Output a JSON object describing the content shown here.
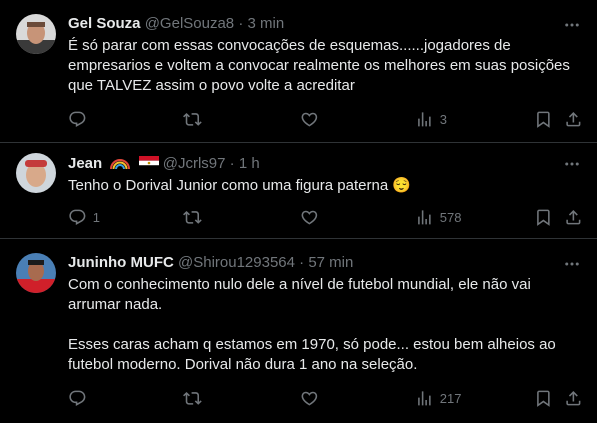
{
  "tweets": [
    {
      "name": "Gel Souza",
      "handle": "@GelSouza8",
      "time": "3 min",
      "text": [
        "É só parar com essas convocações de esquemas......jogadores de empresarios e voltem a convocar realmente os melhores em suas posições que TALVEZ assim o povo volte a acreditar"
      ],
      "replies": "",
      "reposts": "",
      "likes": "",
      "views": "3"
    },
    {
      "name": "Jean",
      "handle": "@Jcrls97",
      "time": "1 h",
      "text": [
        "Tenho o Dorival Junior como uma figura paterna 😌"
      ],
      "replies": "1",
      "reposts": "",
      "likes": "",
      "views": "578"
    },
    {
      "name": "Juninho MUFC",
      "handle": "@Shirou1293564",
      "time": "57 min",
      "text": [
        "Com o conhecimento nulo dele a nível de futebol mundial, ele não vai arrumar nada.",
        "Esses caras acham q estamos em 1970, só pode... estou bem alheios ao futebol moderno. Dorival não dura 1 ano na seleção."
      ],
      "replies": "",
      "reposts": "",
      "likes": "",
      "views": "217"
    }
  ],
  "separator": "·",
  "colors": {
    "background": "#000000",
    "text": "#e7e9ea",
    "muted": "#71767b",
    "border": "#2f3336"
  },
  "icons": [
    "more-icon",
    "reply-icon",
    "repost-icon",
    "like-icon",
    "views-icon",
    "bookmark-icon",
    "share-icon"
  ]
}
